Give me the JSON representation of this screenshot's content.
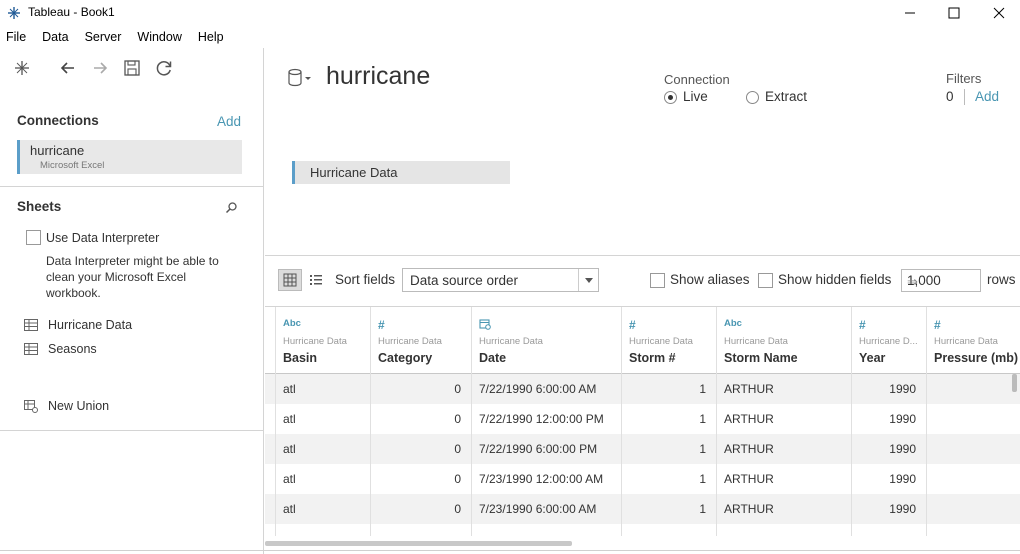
{
  "window": {
    "title": "Tableau - Book1"
  },
  "menu": [
    "File",
    "Data",
    "Server",
    "Window",
    "Help"
  ],
  "left": {
    "connections_title": "Connections",
    "connections_add": "Add",
    "connection": {
      "name": "hurricane",
      "type": "Microsoft Excel"
    },
    "sheets_title": "Sheets",
    "use_interpreter": "Use Data Interpreter",
    "interpreter_help": "Data Interpreter might be able to clean your Microsoft Excel workbook.",
    "sheets": [
      "Hurricane Data",
      "Seasons"
    ],
    "new_union": "New Union"
  },
  "datasource": {
    "title": "hurricane",
    "connection_label": "Connection",
    "live": "Live",
    "extract": "Extract",
    "selected": "Live",
    "filters_label": "Filters",
    "filters_count": "0",
    "filters_add": "Add",
    "table_chip": "Hurricane Data"
  },
  "toolbar": {
    "sort_label": "Sort fields",
    "sort_value": "Data source order",
    "show_aliases": "Show aliases",
    "show_hidden": "Show hidden fields",
    "rows_value": "1,000",
    "rows_label": "rows"
  },
  "grid": {
    "columns": [
      {
        "type": "Abc",
        "source": "Hurricane Data",
        "name": "Basin"
      },
      {
        "type": "#",
        "source": "Hurricane Data",
        "name": "Category"
      },
      {
        "type": "date",
        "source": "Hurricane Data",
        "name": "Date"
      },
      {
        "type": "#",
        "source": "Hurricane Data",
        "name": "Storm #"
      },
      {
        "type": "Abc",
        "source": "Hurricane Data",
        "name": "Storm Name"
      },
      {
        "type": "#",
        "source": "Hurricane D...",
        "name": "Year"
      },
      {
        "type": "#",
        "source": "Hurricane Data",
        "name": "Pressure (mb)"
      }
    ],
    "rows": [
      [
        "atl",
        "0",
        "7/22/1990 6:00:00 AM",
        "1",
        "ARTHUR",
        "1990",
        ""
      ],
      [
        "atl",
        "0",
        "7/22/1990 12:00:00 PM",
        "1",
        "ARTHUR",
        "1990",
        ""
      ],
      [
        "atl",
        "0",
        "7/22/1990 6:00:00 PM",
        "1",
        "ARTHUR",
        "1990",
        ""
      ],
      [
        "atl",
        "0",
        "7/23/1990 12:00:00 AM",
        "1",
        "ARTHUR",
        "1990",
        ""
      ],
      [
        "atl",
        "0",
        "7/23/1990 6:00:00 AM",
        "1",
        "ARTHUR",
        "1990",
        ""
      ]
    ]
  },
  "colors": {
    "accent": "#4996b2",
    "selection_bar": "#5b9ec9"
  }
}
